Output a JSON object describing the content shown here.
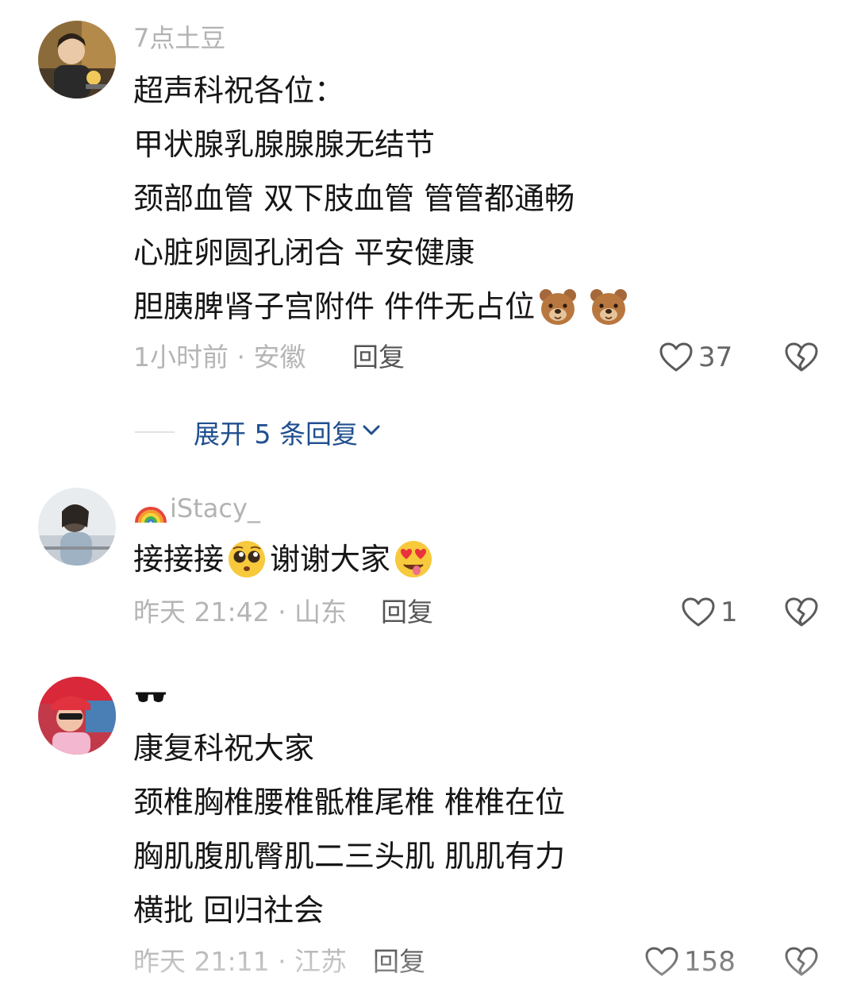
{
  "comments": [
    {
      "username": "7点土豆",
      "lines": [
        "超声科祝各位：",
        "甲状腺乳腺腺腺无结节",
        "颈部血管 双下肢血管 管管都通畅",
        "心脏卵圆孔闭合 平安健康",
        "胆胰脾肾子宫附件 件件无占位"
      ],
      "line5_emojis": [
        "bear-face-emoji",
        "bear-face-emoji"
      ],
      "meta": "1小时前 · 安徽",
      "reply_label": "回复",
      "likes": "37"
    },
    {
      "username_emoji": "rainbow-emoji",
      "username": "iStacy_",
      "line_part1": "接接接",
      "line_emoji1": "pleading-face-emoji",
      "line_part2": "谢谢大家",
      "line_emoji2": "heart-eyes-tongue-emoji",
      "meta": "昨天 21:42 · 山东",
      "reply_label": "回复",
      "likes": "1"
    },
    {
      "username_emoji": "sunglasses-emoji",
      "lines": [
        "康复科祝大家",
        "颈椎胸椎腰椎骶椎尾椎 椎椎在位",
        "胸肌腹肌臀肌二三头肌 肌肌有力",
        "横批 回归社会"
      ],
      "meta": "昨天 21:11 · 江苏",
      "reply_label": "回复",
      "likes": "158"
    }
  ],
  "expand_replies": "展开 5 条回复",
  "colors": {
    "link": "#1f4f8f",
    "meta": "#b5b5b5",
    "text": "#161616"
  }
}
